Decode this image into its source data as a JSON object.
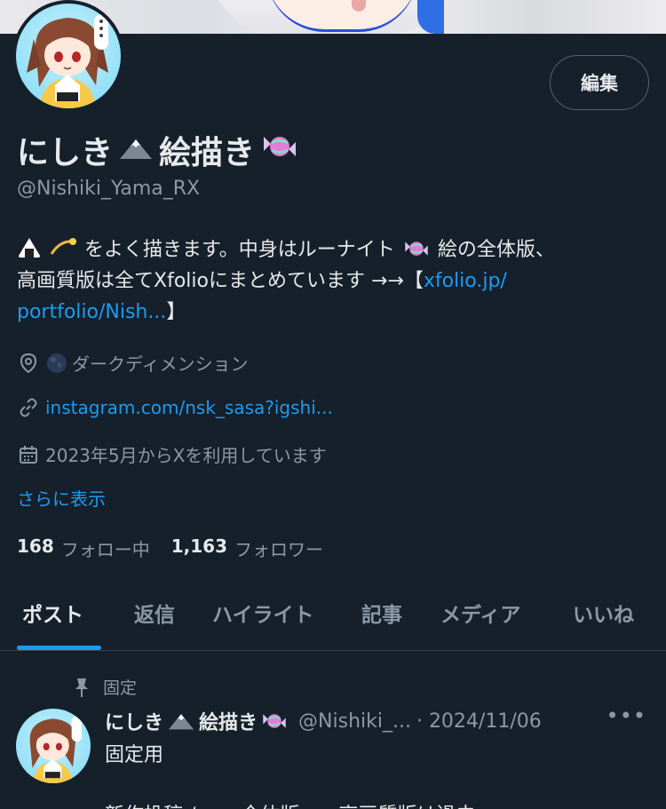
{
  "profile": {
    "name": "にしき",
    "name_suffix": "絵描き",
    "handle": "@Nishiki_Yama_RX",
    "edit_label": "編集",
    "bio_line1": "をよく描きます。中身はルーナイト",
    "bio_line1b": " 絵の全体版、",
    "bio_line2": "高画質版は全てXfolioにまとめています →→【",
    "bio_link_part1": "xfolio.jp/",
    "bio_link_part2": "portfolio/Nish...",
    "bio_end": "】",
    "location": "ダークディメンション",
    "website": "instagram.com/nsk_sasa?igshi...",
    "joined": "2023年5月からXを利用しています",
    "show_more": "さらに表示",
    "following_count": "168",
    "following_label": "フォロー中",
    "followers_count": "1,163",
    "followers_label": "フォロワー"
  },
  "tabs": [
    {
      "label": "ポスト",
      "active": true
    },
    {
      "label": "返信",
      "active": false
    },
    {
      "label": "ハイライト",
      "active": false
    },
    {
      "label": "記事",
      "active": false
    },
    {
      "label": "メディア",
      "active": false
    },
    {
      "label": "いいね",
      "active": false
    }
  ],
  "pinned_post": {
    "pinned_label": "固定",
    "author_name": "にしき",
    "author_suffix": "絵描き",
    "handle": "@Nishiki_...",
    "date": "· 2024/11/06",
    "more": "•••",
    "text": "固定用",
    "cut_text": "新作投稿 / ……全体版……高画質版は過去…"
  },
  "icons": {
    "location": "location-pin-icon",
    "link": "link-icon",
    "calendar": "calendar-icon",
    "pin": "pin-icon",
    "mountain": "mountain-icon",
    "candy": "candy-icon"
  },
  "colors": {
    "background": "#15202b",
    "accent": "#1d9bf0",
    "muted": "#8b98a5",
    "border": "#38444d"
  }
}
